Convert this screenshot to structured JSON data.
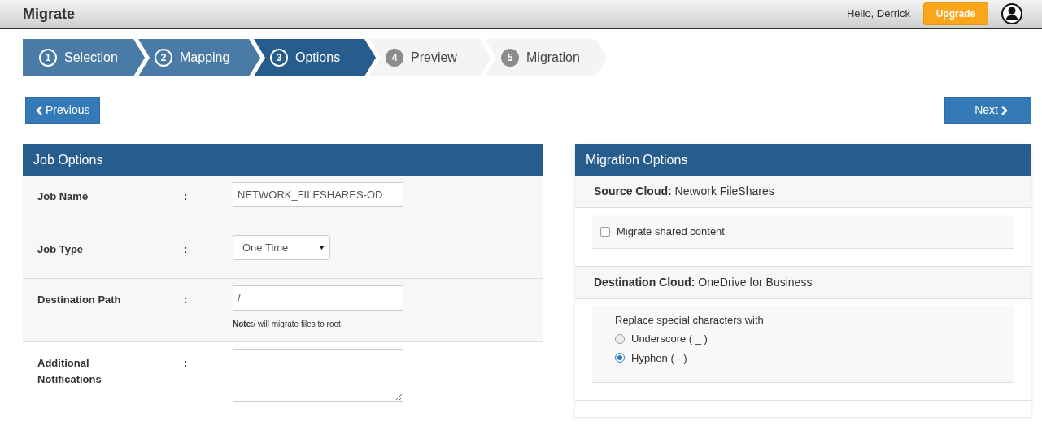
{
  "header": {
    "title": "Migrate",
    "greeting": "Hello, Derrick",
    "upgrade_button": "Upgrade"
  },
  "steps": [
    {
      "number": "1",
      "label": "Selection",
      "done": true,
      "selected": false
    },
    {
      "number": "2",
      "label": "Mapping",
      "done": true,
      "selected": false
    },
    {
      "number": "3",
      "label": "Options",
      "done": false,
      "selected": true
    },
    {
      "number": "4",
      "label": "Preview",
      "done": false,
      "selected": false
    },
    {
      "number": "5",
      "label": "Migration",
      "done": false,
      "selected": false
    }
  ],
  "nav_buttons": {
    "previous": "Previous",
    "next": "Next"
  },
  "job_options": {
    "title": "Job Options",
    "rows": [
      {
        "kind": "text",
        "label": "Job Name",
        "separator": ":",
        "value": "NETWORK_FILESHARES-OD"
      },
      {
        "kind": "select",
        "label": "Job Type",
        "separator": ":",
        "value": "One Time"
      },
      {
        "kind": "text",
        "label": "Destination Path",
        "separator": ":",
        "value": "/",
        "note": "**Note:**/ will migrate files to root"
      },
      {
        "kind": "textarea",
        "label": "Additional Notifications",
        "separator": ":"
      }
    ]
  },
  "migration_options": {
    "title": "Migration Options",
    "source": {
      "text": "**Source Cloud:** Network FileShares",
      "options": [
        {
          "label": "Migrate shared content",
          "checked": false
        }
      ]
    },
    "destination": {
      "text": "**Destination Cloud:** OneDrive for Business",
      "group_label": "Replace special characters with",
      "choices": [
        {
          "label": "Underscore ( _ )",
          "selected": false
        },
        {
          "label": "Hyphen ( - )",
          "selected": true
        }
      ]
    }
  }
}
